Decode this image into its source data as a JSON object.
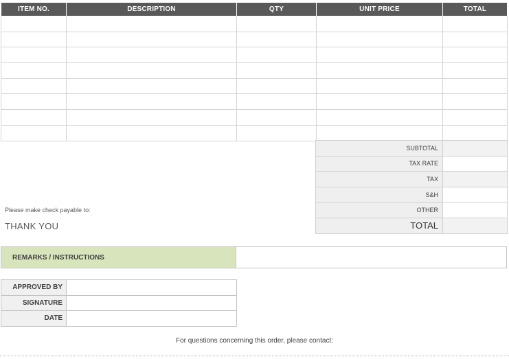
{
  "items_table": {
    "headers": [
      "ITEM NO.",
      "DESCRIPTION",
      "QTY",
      "UNIT PRICE",
      "TOTAL"
    ],
    "rows": [
      [
        "",
        "",
        "",
        "",
        ""
      ],
      [
        "",
        "",
        "",
        "",
        ""
      ],
      [
        "",
        "",
        "",
        "",
        ""
      ],
      [
        "",
        "",
        "",
        "",
        ""
      ],
      [
        "",
        "",
        "",
        "",
        ""
      ],
      [
        "",
        "",
        "",
        "",
        ""
      ],
      [
        "",
        "",
        "",
        "",
        ""
      ],
      [
        "",
        "",
        "",
        "",
        ""
      ]
    ]
  },
  "totals": {
    "subtotal_label": "SUBTOTAL",
    "tax_rate_label": "TAX RATE",
    "tax_label": "TAX",
    "sh_label": "S&H",
    "other_label": "OTHER",
    "total_label": "TOTAL"
  },
  "payable_text": "Please make check payable to:",
  "thank_you": "THANK YOU",
  "remarks": {
    "label": "REMARKS / INSTRUCTIONS",
    "value": ""
  },
  "approval": {
    "approved_by_label": "APPROVED BY",
    "signature_label": "SIGNATURE",
    "date_label": "DATE"
  },
  "contact_text": "For questions concerning this order, please contact:",
  "colors": {
    "header_bg": "#595959",
    "remarks_bg": "#d8e4bc",
    "label_bg": "#efefef"
  }
}
